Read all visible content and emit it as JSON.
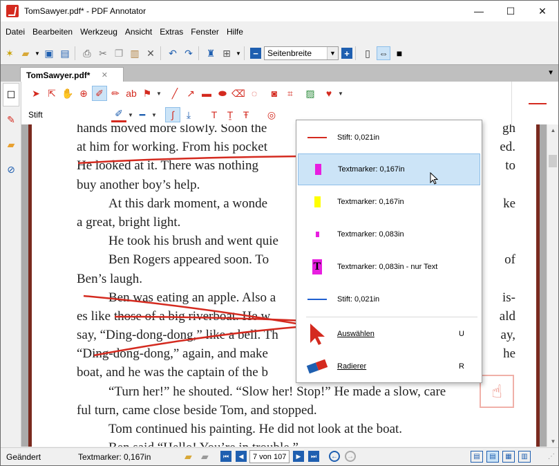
{
  "window": {
    "title": "TomSawyer.pdf* - PDF Annotator",
    "controls": [
      "—",
      "☐",
      "✕"
    ]
  },
  "menu": [
    "Datei",
    "Bearbeiten",
    "Werkzeug",
    "Ansicht",
    "Extras",
    "Fenster",
    "Hilfe"
  ],
  "toolbar": {
    "zoom_value": "Seitenbreite"
  },
  "tabs": {
    "active": "TomSawyer.pdf*",
    "close": "✕"
  },
  "annot_toolbar": {
    "tool_label": "Stift",
    "pen_color": "#d42a1f"
  },
  "document_lines": [
    "hands moved more slowly. Soon the",
    "at him for working. From his pocket",
    "He looked at it. There was nothing",
    "buy another boy’s help.",
    "At this dark moment, a wonde",
    "a great, bright light.",
    "He took his brush and went quie",
    "Ben Rogers appeared soon. To",
    "Ben’s laugh.",
    "Ben was eating an apple. Also a",
    "es like those of a big riverboat. He w",
    "say, “Ding-dong-dong,” like a bell. Th",
    "“Ding-dong-dong,” again, and make",
    "boat, and he was the captain of the b",
    "“Turn her!” he shouted. “Slow her! Stop!” He made a slow, care",
    "ful turn, came close beside Tom, and stopped.",
    "Tom continued his painting. He did not look at the boat.",
    "Ben said “Hello! You’re in trouble.”"
  ],
  "document_right_fragments": [
    "gh",
    "ed.",
    "to",
    "ke",
    "of",
    "is-",
    "ald",
    "ay,",
    "he"
  ],
  "dropdown": {
    "items": [
      {
        "label": "Stift: 0,021in",
        "key": ""
      },
      {
        "label": "Textmarker: 0,167in",
        "key": ""
      },
      {
        "label": "Textmarker: 0,167in",
        "key": ""
      },
      {
        "label": "Textmarker: 0,083in",
        "key": ""
      },
      {
        "label": "Textmarker: 0,083in - nur Text",
        "key": ""
      },
      {
        "label": "Stift: 0,021in",
        "key": ""
      },
      {
        "label": "Auswählen",
        "key": "U"
      },
      {
        "label": "Radierer",
        "key": "R"
      }
    ],
    "highlighted_index": 1
  },
  "status": {
    "state": "Geändert",
    "tool": "Textmarker: 0,167in",
    "page_indicator": "7 von 107"
  },
  "colors": {
    "accent_red": "#d42a1f",
    "highlight_blue": "#cce4f7",
    "magenta": "#e81ee0",
    "yellow": "#ffff00",
    "pen_blue": "#1f5fd0"
  }
}
